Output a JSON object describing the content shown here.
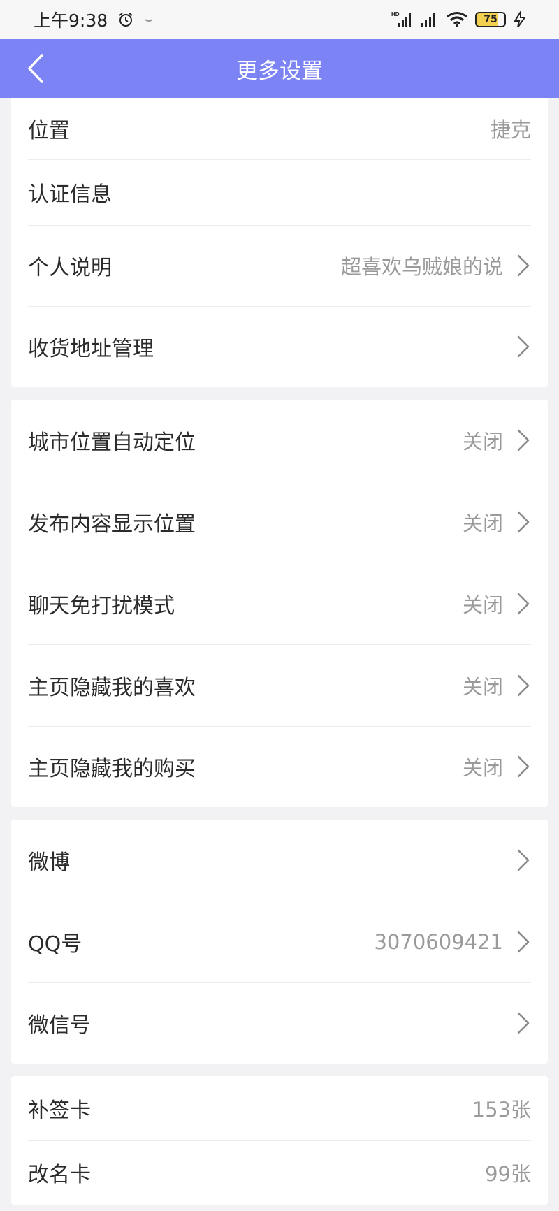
{
  "status_bar": {
    "time": "上午9:38",
    "network_label": "HD",
    "battery": "75"
  },
  "nav": {
    "title": "更多设置"
  },
  "groups": [
    {
      "rows": [
        {
          "label": "位置",
          "value": "捷克"
        },
        {
          "label": "认证信息",
          "value": ""
        },
        {
          "label": "个人说明",
          "value": "超喜欢乌贼娘的说"
        },
        {
          "label": "收货地址管理",
          "value": ""
        }
      ]
    },
    {
      "rows": [
        {
          "label": "城市位置自动定位",
          "value": "关闭"
        },
        {
          "label": "发布内容显示位置",
          "value": "关闭"
        },
        {
          "label": "聊天免打扰模式",
          "value": "关闭"
        },
        {
          "label": "主页隐藏我的喜欢",
          "value": "关闭"
        },
        {
          "label": "主页隐藏我的购买",
          "value": "关闭"
        }
      ]
    },
    {
      "rows": [
        {
          "label": "微博",
          "value": ""
        },
        {
          "label": "QQ号",
          "value": "3070609421"
        },
        {
          "label": "微信号",
          "value": ""
        }
      ]
    },
    {
      "rows": [
        {
          "label": "补签卡",
          "value": "153张"
        },
        {
          "label": "改名卡",
          "value": "99张"
        }
      ]
    }
  ],
  "colors": {
    "accent": "#7b83f5",
    "background": "#f2f2f4"
  }
}
